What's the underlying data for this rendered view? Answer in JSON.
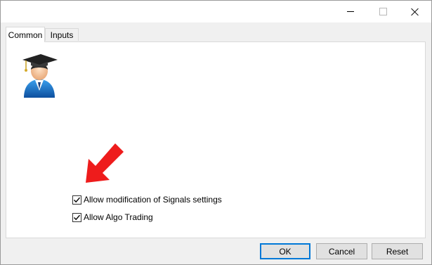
{
  "window": {
    "title": ""
  },
  "titlebar": {
    "minimize_icon": "minimize-icon",
    "maximize_icon": "maximize-icon",
    "close_icon": "close-icon"
  },
  "tabs": [
    {
      "label": "Common",
      "active": true
    },
    {
      "label": "Inputs",
      "active": false
    }
  ],
  "panel": {
    "avatar_icon": "graduate-avatar-icon",
    "arrow_icon": "red-arrow-icon",
    "checkboxes": [
      {
        "label": "Allow modification of Signals settings",
        "checked": true
      },
      {
        "label": "Allow Algo Trading",
        "checked": true
      }
    ]
  },
  "footer": {
    "ok_label": "OK",
    "cancel_label": "Cancel",
    "reset_label": "Reset"
  },
  "colors": {
    "accent": "#0078d7",
    "arrow": "#ee1c1c"
  }
}
